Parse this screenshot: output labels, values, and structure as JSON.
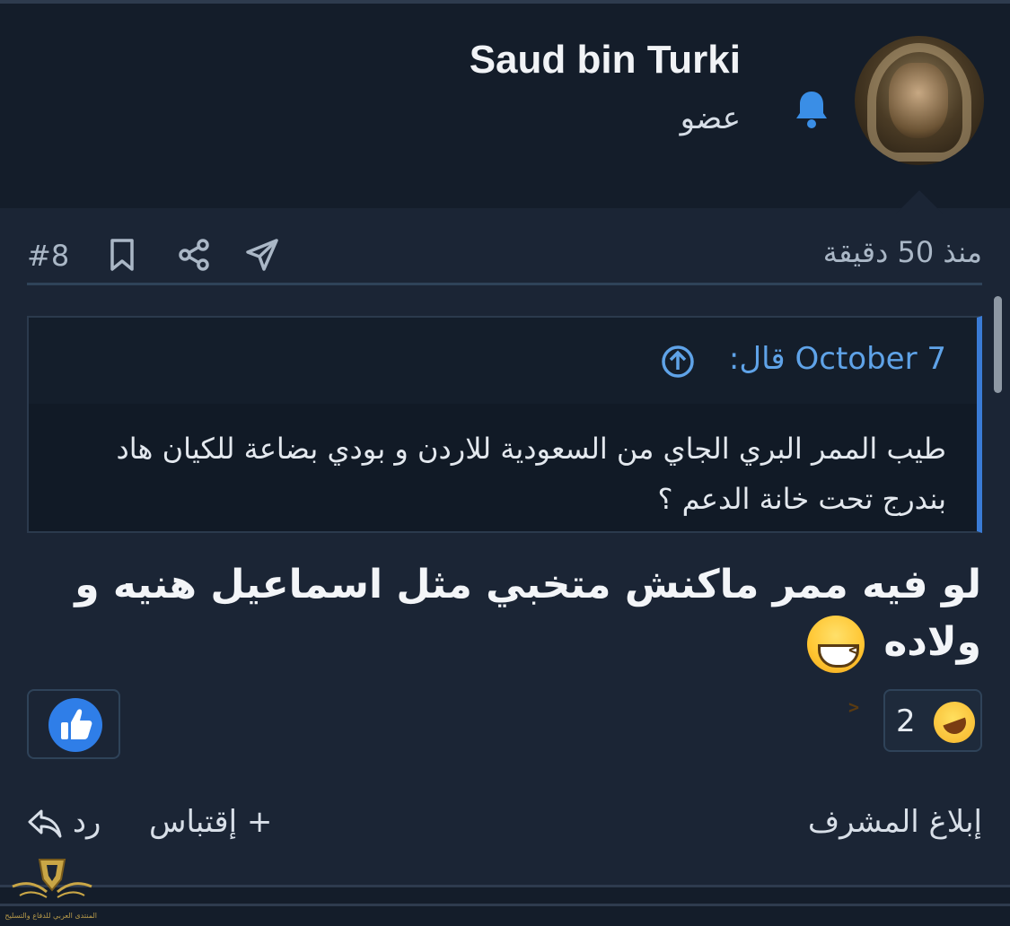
{
  "header": {
    "username": "Saud bin Turki",
    "role": "عضو"
  },
  "meta": {
    "time": "منذ 50 دقيقة",
    "post_number": "#8"
  },
  "quote": {
    "author": "October 7 قال:",
    "text": "طيب الممر البري الجاي من السعودية للاردن و بودي بضاعة للكيان هاد بندرج تحت خانة الدعم ؟"
  },
  "post": {
    "body": "لو فيه ممر ماكنش متخبي مثل اسماعيل هنيه و ولاده"
  },
  "reactions": {
    "count": "2"
  },
  "footer": {
    "report": "إبلاغ المشرف",
    "quote": "+ إقتباس",
    "reply": "رد"
  },
  "watermark": {
    "text": "المنتدى العربي للدفاع والتسليح"
  },
  "colors": {
    "accent": "#3a7bd5",
    "link": "#5fa3e8",
    "like": "#2f7ee8"
  }
}
